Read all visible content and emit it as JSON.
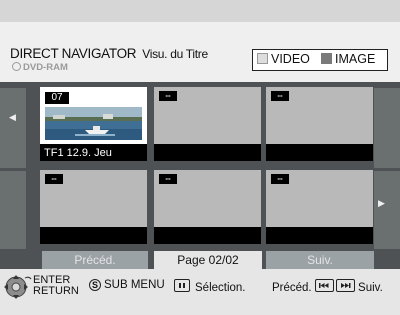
{
  "header": {
    "title": "DIRECT NAVIGATOR",
    "subtitle": "Visu. du Titre",
    "disc": "DVD-RAM",
    "modes": [
      {
        "label": "VIDEO",
        "selected": true
      },
      {
        "label": "IMAGE",
        "selected": false
      }
    ]
  },
  "grid": {
    "cells": [
      {
        "number": "07",
        "label": "TF1   12.9. Jeu",
        "selected": true,
        "has_thumbnail": true
      },
      {
        "number": "--",
        "label": "",
        "selected": false,
        "has_thumbnail": false
      },
      {
        "number": "--",
        "label": "",
        "selected": false,
        "has_thumbnail": false
      },
      {
        "number": "--",
        "label": "",
        "selected": false,
        "has_thumbnail": false
      },
      {
        "number": "--",
        "label": "",
        "selected": false,
        "has_thumbnail": false
      },
      {
        "number": "--",
        "label": "",
        "selected": false,
        "has_thumbnail": false
      }
    ]
  },
  "nav": {
    "prev_label": "Précéd.",
    "page_label": "Page 02/02",
    "next_label": "Suiv."
  },
  "footer": {
    "enter": "ENTER",
    "return": "RETURN",
    "submenu_key": "S",
    "submenu": "SUB MENU",
    "select": "Sélection.",
    "prev": "Précéd.",
    "next": "Suiv."
  },
  "colors": {
    "grid_bg": "#4e5254",
    "cell_bg": "#b9b9b9",
    "nav_button": "#9aa2a6"
  }
}
